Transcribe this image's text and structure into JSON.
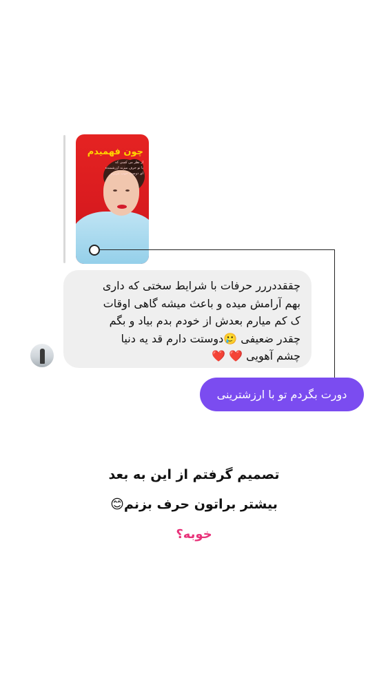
{
  "shared_story": {
    "title": "چون فهمیدم",
    "lines": [
      "از نظر من کسی که",
      "با تو حرف میزنه ارزشمنده",
      "ای دوست خوب عزیزم"
    ]
  },
  "message": {
    "lines": [
      "چققددررر حرفات با شرایط سختی که داری",
      "بهم آرامش میده و باعث میشه گاهی اوقات",
      "ک کم میارم بعدش از خودم بدم بیاد و بگم",
      "چقدر ضعیفی 🥲دوستت دارم قد یه دنیا",
      "چشم آهویی ❤️ ❤️"
    ]
  },
  "reply": {
    "text": "دورت بگردم تو با ارزشترینی"
  },
  "caption": {
    "line1": "تصمیم گرفتم از این به بعد",
    "line2": "بیشتر براتون حرف بزنم😊",
    "line3": "خوبه؟"
  },
  "colors": {
    "reply_bg": "#7b4cf0",
    "message_bg": "#efefef",
    "accent_pink": "#e8337a"
  },
  "icons": {
    "avatar": "user-avatar",
    "connector": "circle-connector-icon"
  }
}
